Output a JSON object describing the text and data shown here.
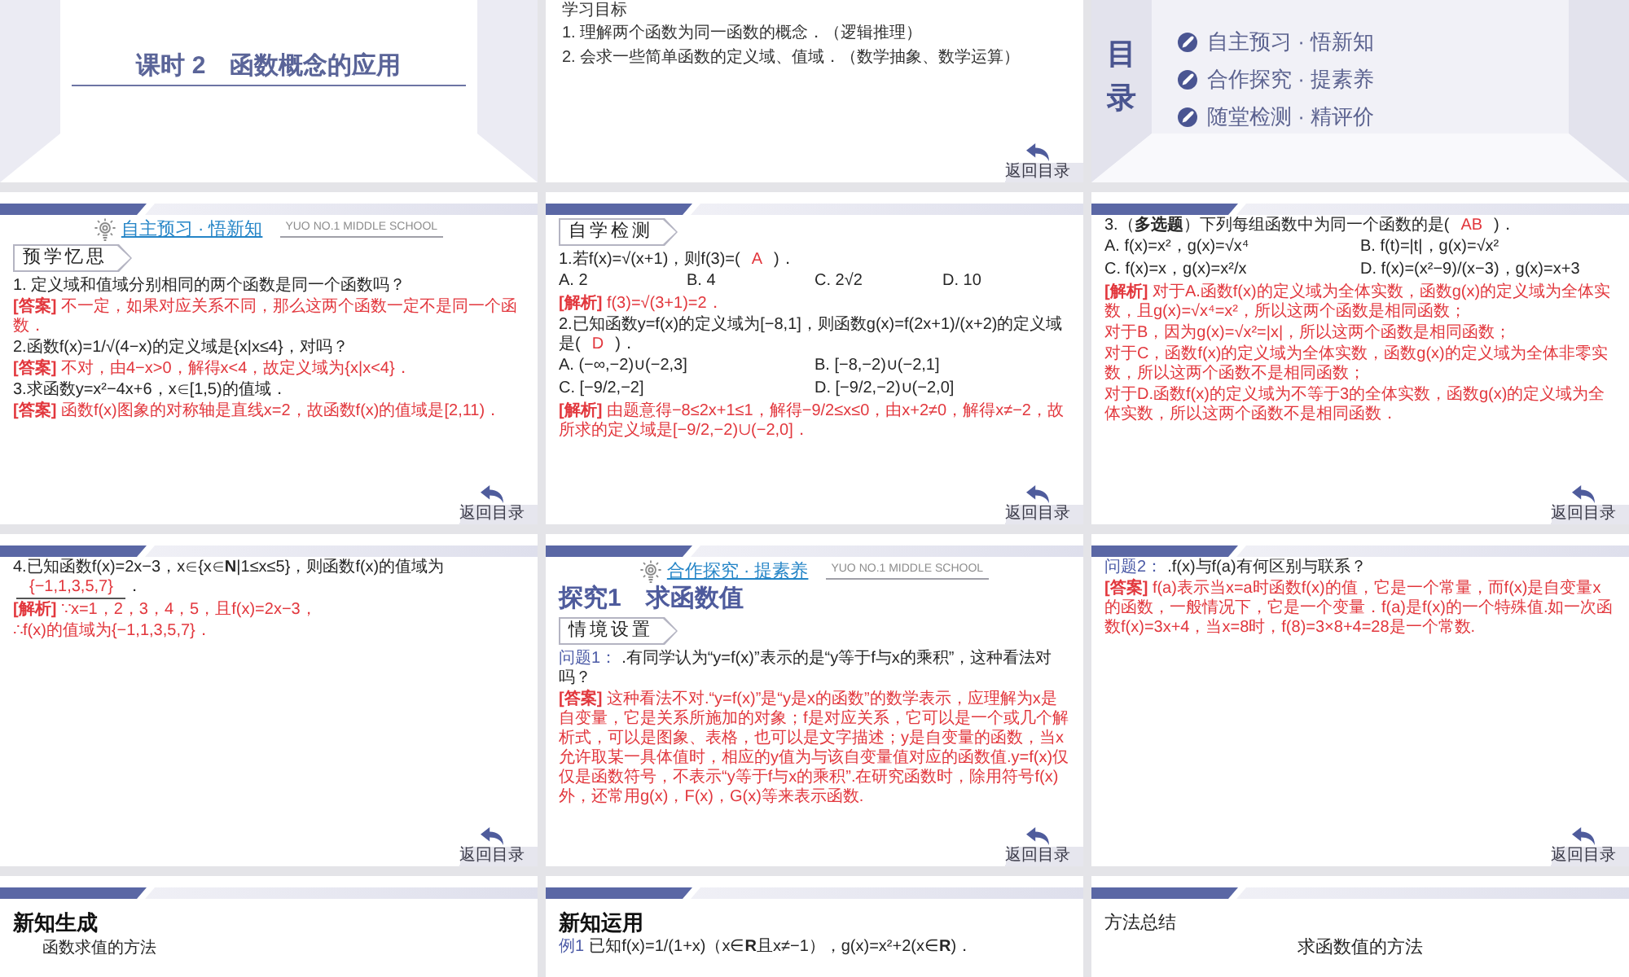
{
  "slides": [
    {
      "kind": "title",
      "title": "课时 2　函数概念的应用"
    },
    {
      "kind": "objectives",
      "heading": "学习目标",
      "lines": [
        "1. 理解两个函数为同一函数的概念．（逻辑推理）",
        "2. 会求一些简单函数的定义域、值域．（数学抽象、数学运算）"
      ],
      "back": "返回目录"
    },
    {
      "kind": "contents",
      "heading": "目录",
      "items": [
        "自主预习 · 悟新知",
        "合作探究 · 提素养",
        "随堂检测 · 精评价"
      ]
    },
    {
      "kind": "lesson",
      "blocks": [
        {
          "kind": "section",
          "title": "自主预习 · 悟新知",
          "school": "YUO NO.1 MIDDLE SCHOOL"
        },
        {
          "kind": "badge",
          "text": "预学忆思"
        },
        {
          "kind": "question",
          "text": "1. 定义域和值域分别相同的两个函数是同一个函数吗？"
        },
        {
          "kind": "answer",
          "text": "**[答案]** 不一定，如果对应关系不同，那么这两个函数一定不是同一个函数．"
        },
        {
          "kind": "question",
          "text": "2.函数f(x)=1/√(4−x)的定义域是{x|x≤4}，对吗？"
        },
        {
          "kind": "answer",
          "text": "**[答案]** 不对，由4−x>0，解得x<4，故定义域为{x|x<4}．"
        },
        {
          "kind": "question",
          "text": "3.求函数y=x²−4x+6，x∈[1,5)的值域．"
        },
        {
          "kind": "answer",
          "text": "**[答案]** 函数f(x)图象的对称轴是直线x=2，故函数f(x)的值域是[2,11)．"
        }
      ],
      "back": "返回目录"
    },
    {
      "kind": "lesson",
      "blocks": [
        {
          "kind": "badge",
          "text": "自学检测"
        },
        {
          "kind": "question",
          "text": "1.若f(x)=√(x+1)，则f(3)=(",
          "choice": "A",
          "after": ")．"
        },
        {
          "kind": "options",
          "rows": [
            [
              "A. 2",
              "B. 4",
              "C. 2√2",
              "D. 10"
            ]
          ]
        },
        {
          "kind": "answer",
          "text": "**[解析]** f(3)=√(3+1)=2．"
        },
        {
          "kind": "question",
          "text": "2.已知函数y=f(x)的定义域为[−8,1]，则函数g(x)=f(2x+1)/(x+2)的定义域是(",
          "choice": "D",
          "after": ")．"
        },
        {
          "kind": "options",
          "rows": [
            [
              "A. (−∞,−2)∪(−2,3]",
              "B. [−8,−2)∪(−2,1]"
            ],
            [
              "C. [−9/2,−2]",
              "D. [−9/2,−2)∪(−2,0]"
            ]
          ]
        },
        {
          "kind": "answer",
          "text": "**[解析]** 由题意得−8≤2x+1≤1，解得−9/2≤x≤0，由x+2≠0，解得x≠−2，故所求的定义域是[−9/2,−2)∪(−2,0]．"
        }
      ],
      "back": "返回目录"
    },
    {
      "kind": "lesson",
      "blocks": [
        {
          "kind": "question",
          "text": "3.（**多选题**）下列每组函数中为同一个函数的是(",
          "choice": "AB",
          "after": ")．"
        },
        {
          "kind": "options",
          "rows": [
            [
              "A. f(x)=x²，g(x)=√x⁴",
              "B. f(t)=|t|，g(x)=√x²"
            ],
            [
              "C. f(x)=x，g(x)=x²/x",
              "D. f(x)=(x²−9)/(x−3)，g(x)=x+3"
            ]
          ]
        },
        {
          "kind": "answer",
          "text": "**[解析]** 对于A.函数f(x)的定义域为全体实数，函数g(x)的定义域为全体实数，且g(x)=√x⁴=x²，所以这两个函数是相同函数；"
        },
        {
          "kind": "answer",
          "text": "对于B，因为g(x)=√x²=|x|，所以这两个函数是相同函数；"
        },
        {
          "kind": "answer",
          "text": "对于C，函数f(x)的定义域为全体实数，函数g(x)的定义域为全体非零实数，所以这两个函数不是相同函数；"
        },
        {
          "kind": "answer",
          "text": "对于D.函数f(x)的定义域为不等于3的全体实数，函数g(x)的定义域为全体实数，所以这两个函数不是相同函数．"
        }
      ],
      "back": "返回目录"
    },
    {
      "kind": "lesson",
      "blocks": [
        {
          "kind": "fill",
          "text": "4.已知函数f(x)=2x−3，x∈{x∈**N**|1≤x≤5}，则函数f(x)的值域为",
          "blank": "{−1,1,3,5,7}",
          "after": "．"
        },
        {
          "kind": "answer",
          "text": "**[解析]** ∵x=1，2，3，4，5，且f(x)=2x−3，"
        },
        {
          "kind": "answer",
          "text": "∴f(x)的值域为{−1,1,3,5,7}．"
        }
      ],
      "back": "返回目录"
    },
    {
      "kind": "lesson",
      "blocks": [
        {
          "kind": "section",
          "title": "合作探究 · 提素养",
          "school": "YUO NO.1 MIDDLE SCHOOL"
        },
        {
          "kind": "title",
          "text": "探究1　求函数值"
        },
        {
          "kind": "badge",
          "text": "情境设置"
        },
        {
          "kind": "question",
          "lead": "问题1：",
          "text": ".有同学认为“y=f(x)”表示的是“y等于f与x的乘积”，这种看法对吗？"
        },
        {
          "kind": "answer",
          "text": "**[答案]** 这种看法不对.“y=f(x)”是“y是x的函数”的数学表示，应理解为x是自变量，它是关系所施加的对象；f是对应关系，它可以是一个或几个解析式，可以是图象、表格，也可以是文字描述；y是自变量的函数，当x允许取某一具体值时，相应的y值为与该自变量值对应的函数值.y=f(x)仅仅是函数符号，不表示“y等于f与x的乘积”.在研究函数时，除用符号f(x)外，还常用g(x)，F(x)，G(x)等来表示函数."
        }
      ],
      "back": "返回目录"
    },
    {
      "kind": "lesson",
      "blocks": [
        {
          "kind": "question",
          "lead": "问题2：",
          "text": ".f(x)与f(a)有何区别与联系？"
        },
        {
          "kind": "answer",
          "text": "**[答案]** f(a)表示当x=a时函数f(x)的值，它是一个常量，而f(x)是自变量x的函数，一般情况下，它是一个变量．f(a)是f(x)的一个特殊值.如一次函数f(x)=3x+4，当x=8时，f(8)=3×8+4=28是一个常数."
        }
      ],
      "back": "返回目录"
    },
    {
      "kind": "lesson",
      "blocks": [
        {
          "kind": "heading",
          "text": "新知生成"
        },
        {
          "kind": "subheading",
          "text": "函数求值的方法"
        }
      ]
    },
    {
      "kind": "lesson",
      "blocks": [
        {
          "kind": "heading",
          "text": "新知运用"
        },
        {
          "kind": "question",
          "lead": "例1",
          "text": "已知f(x)=1/(1+x)（x∈**R**且x≠−1），g(x)=x²+2(x∈**R**)．"
        }
      ]
    },
    {
      "kind": "lesson",
      "blocks": [
        {
          "kind": "label",
          "text": "方法总结"
        },
        {
          "kind": "caption",
          "text": "求函数值的方法"
        }
      ]
    }
  ]
}
